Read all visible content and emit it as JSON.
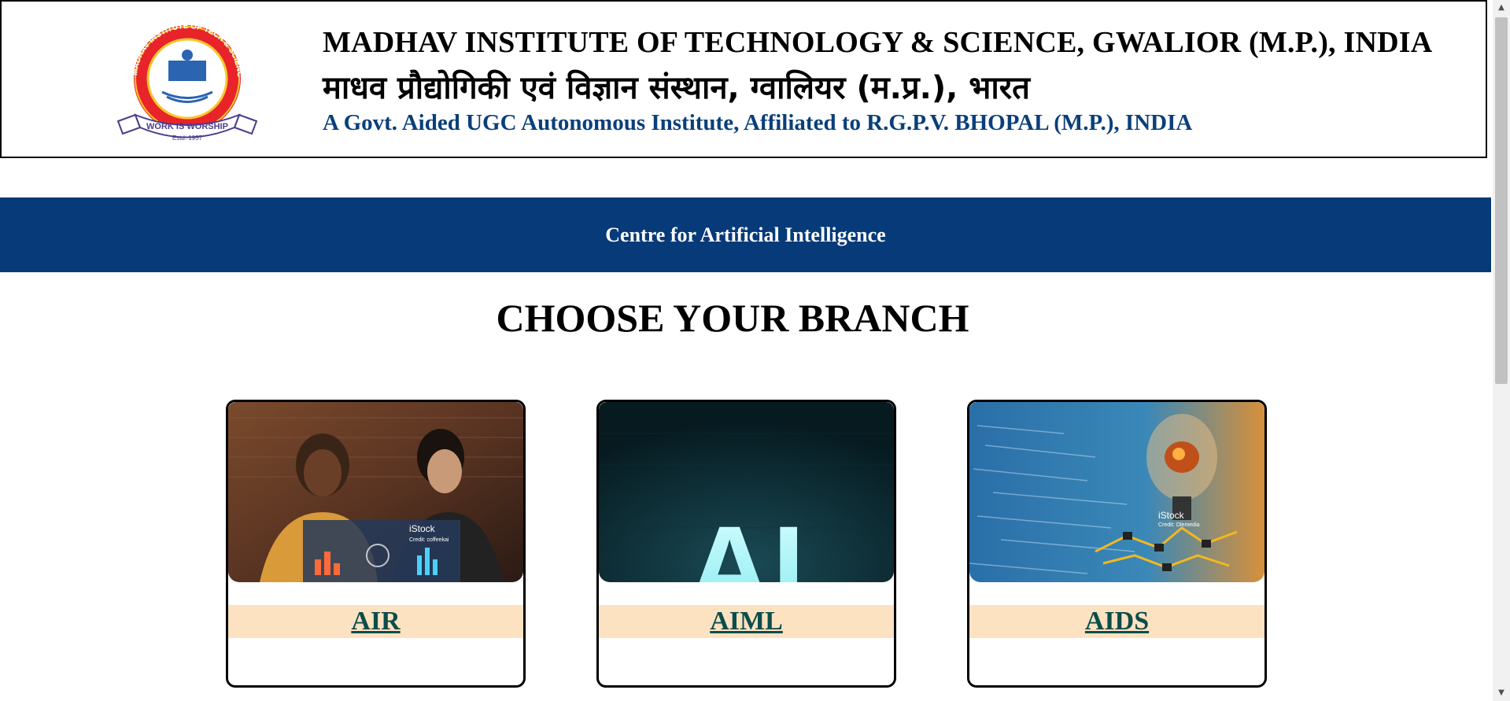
{
  "header": {
    "logo_text_top": "MADHAV INSTITUTE OF TECH & SCIENCE",
    "logo_motto": "WORK IS WORSHIP",
    "logo_estd": "Estd. 1957",
    "title_en": "MADHAV INSTITUTE OF TECHNOLOGY & SCIENCE, GWALIOR (M.P.), INDIA",
    "title_hi": "माधव प्रौद्योगिकी एवं विज्ञान संस्थान, ग्वालियर (म.प्र.), भारत",
    "subtitle": "A Govt. Aided UGC Autonomous Institute, Affiliated to R.G.P.V. BHOPAL (M.P.), INDIA"
  },
  "band": {
    "title": "Centre for Artificial Intelligence"
  },
  "main": {
    "heading": "CHOOSE YOUR BRANCH",
    "cards": [
      {
        "label": "AIR",
        "image": "two-students-laptop-image",
        "watermark": "iStock",
        "credit": "Credit: coffeekai"
      },
      {
        "label": "AIML",
        "image": "ai-glowing-letters-image",
        "big_text": "AI"
      },
      {
        "label": "AIDS",
        "image": "lightbulb-brain-circuit-image",
        "watermark": "iStock",
        "credit": "Credit: Olemedia"
      }
    ]
  },
  "colors": {
    "accent_blue": "#063a79",
    "subtitle_blue": "#0a3f7a",
    "card_band": "#fde2c2",
    "link_color": "#0b4d4a"
  }
}
